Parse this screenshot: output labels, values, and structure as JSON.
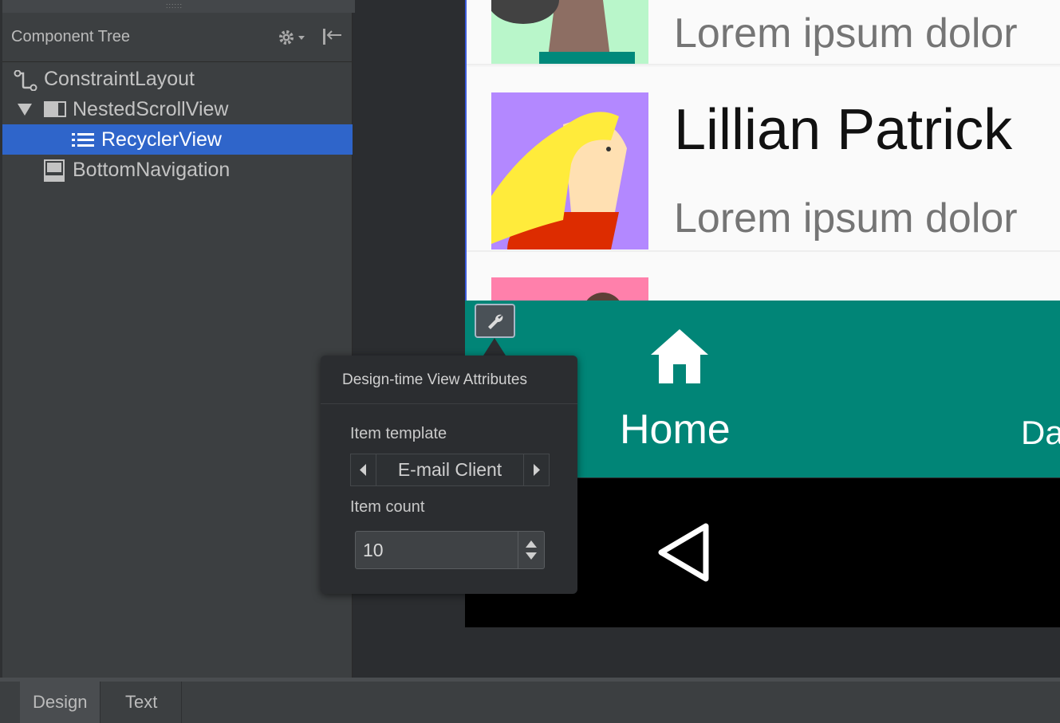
{
  "tree_panel": {
    "title": "Component Tree",
    "items": [
      {
        "label": "ConstraintLayout",
        "icon": "constraint-layout-icon"
      },
      {
        "label": "NestedScrollView",
        "icon": "scroll-view-icon"
      },
      {
        "label": "RecyclerView",
        "icon": "list-icon",
        "selected": true
      },
      {
        "label": "BottomNavigation",
        "icon": "bottom-navigation-icon"
      }
    ]
  },
  "device": {
    "list_items": [
      {
        "name": "",
        "body": "Lorem ipsum dolor",
        "avatar_color": "#b9f6ca"
      },
      {
        "name": "Lillian Patrick",
        "body": "Lorem ipsum dolor",
        "avatar_color": "#b388ff"
      },
      {
        "name": "",
        "body": "",
        "avatar_color": "#ff80ab"
      }
    ],
    "bottom_nav": {
      "home_label": "Home",
      "second_label": "Da",
      "color": "#018577"
    }
  },
  "popover": {
    "title": "Design-time View Attributes",
    "item_template_label": "Item template",
    "item_template_value": "E-mail Client",
    "item_count_label": "Item count",
    "item_count_value": "10"
  },
  "bottom_tabs": {
    "design": "Design",
    "text": "Text"
  }
}
